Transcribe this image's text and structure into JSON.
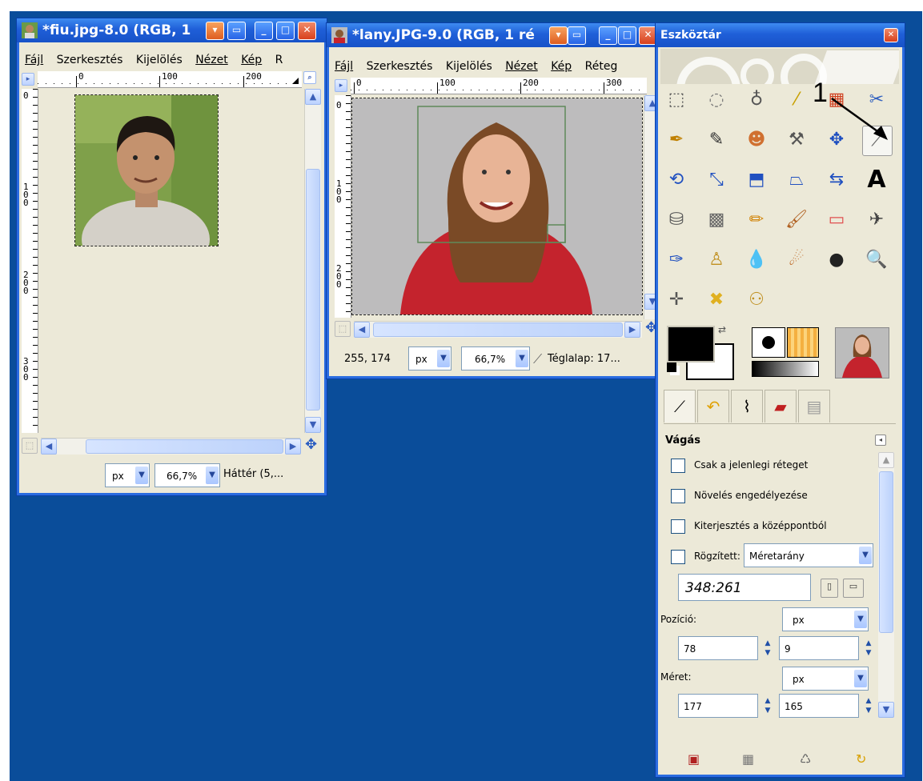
{
  "win1": {
    "title": "*fiu.jpg-8.0 (RGB, 1",
    "menu": [
      "Fájl",
      "Szerkesztés",
      "Kijelölés",
      "Nézet",
      "Kép",
      "R"
    ],
    "ruler_h_labels": [
      "0",
      "100",
      "200"
    ],
    "ruler_v_labels": [
      "0",
      "1\n0\n0",
      "2\n0\n0",
      "3\n0\n0"
    ],
    "status": {
      "unit": "px",
      "zoom": "66,7%",
      "info": "Háttér (5,..."
    }
  },
  "win2": {
    "title": "*lany.JPG-9.0 (RGB, 1 ré",
    "menu": [
      "Fájl",
      "Szerkesztés",
      "Kijelölés",
      "Nézet",
      "Kép",
      "Réteg"
    ],
    "ruler_h_labels": [
      "0",
      "100",
      "200",
      "300"
    ],
    "ruler_v_labels": [
      "0",
      "1\n0\n0",
      "2\n0\n0"
    ],
    "status": {
      "coords": "255, 174",
      "unit": "px",
      "zoom": "66,7%",
      "info": "Téglalap: 17..."
    }
  },
  "toolbox": {
    "title": "Eszköztár",
    "annotation": "1",
    "tool_icons": [
      "rect-select-icon",
      "ellipse-select-icon",
      "lasso-icon",
      "fuzzy-select-icon",
      "select-by-color-icon",
      "scissors-icon",
      "paths-icon",
      "color-picker-icon",
      "clone-person-icon",
      "compass-icon",
      "move-icon",
      "crop-knife-icon",
      "rotate-icon",
      "scale-icon",
      "shear-icon",
      "perspective-icon",
      "flip-icon",
      "text-icon",
      "bucket-fill-icon",
      "blend-icon",
      "pencil-icon",
      "paintbrush-icon",
      "eraser-icon",
      "airbrush-icon",
      "ink-icon",
      "clone-stamp-icon",
      "blur-drop-icon",
      "smudge-icon",
      "dodge-burn-icon",
      "zoom-icon",
      "measure-icon",
      "heal-icon",
      "person-tool-icon"
    ],
    "tool_glyphs": [
      "⬚",
      "◌",
      "♁",
      "⁄",
      "▦",
      "✂",
      "✒",
      "✎",
      "☻",
      "⚒",
      "✥",
      "⟋",
      "⟲",
      "⤡",
      "⬒",
      "⏢",
      "⇆",
      "A",
      "⛁",
      "▩",
      "✏",
      "🖌",
      "▭",
      "✈",
      "✑",
      "♙",
      "💧",
      "☄",
      "●",
      "🔍",
      "✛",
      "✖",
      "⚇"
    ],
    "options": {
      "heading": "Vágás",
      "checkboxes": [
        "Csak a jelenlegi réteget",
        "Növelés engedélyezése",
        "Kiterjesztés a középpontból",
        "Rögzített:"
      ],
      "fixed_select": "Méretarány",
      "ratio": "348:261",
      "position_label": "Pozíció:",
      "position_unit": "px",
      "pos_x": "78",
      "pos_y": "9",
      "size_label": "Méret:",
      "size_unit": "px",
      "size_w": "177",
      "size_h": "165"
    }
  }
}
